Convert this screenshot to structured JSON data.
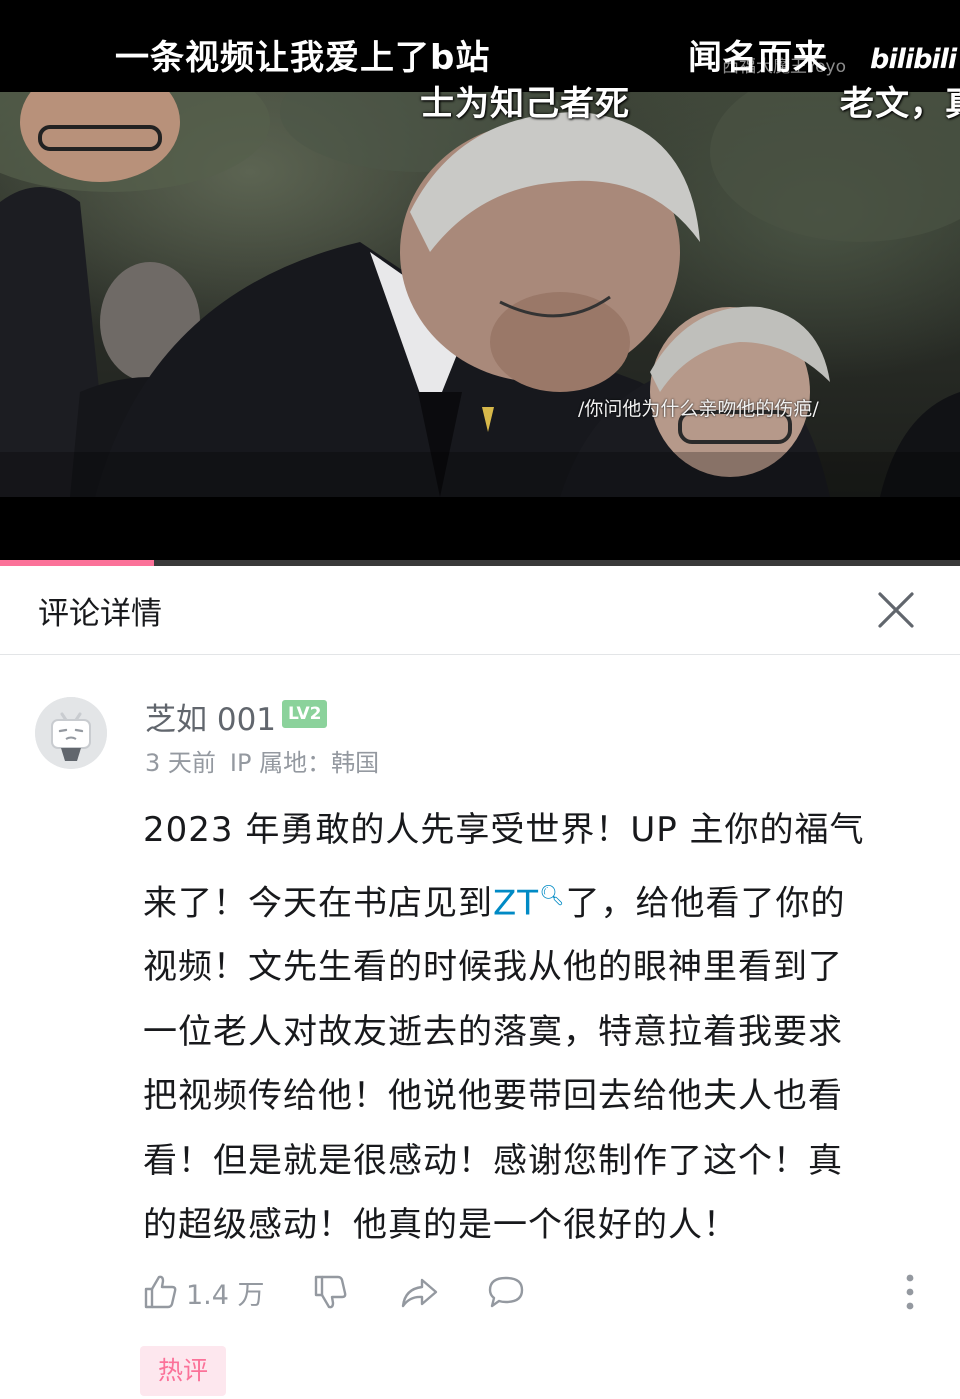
{
  "video": {
    "danmaku": [
      "一条视频让我爱上了b站",
      "闻名而来",
      "士为知己者死",
      "老文，真"
    ],
    "caption": "/你问他为什么亲吻他的伤疤/",
    "uploader_watermark": "西福大魔王Yoyo",
    "brand_logo": "bilibili",
    "progress_fraction": 0.16,
    "accent_color": "#fb7299"
  },
  "panel": {
    "title": "评论详情",
    "close_icon": "close-icon"
  },
  "comment": {
    "username": "芝如 001",
    "level": "LV2",
    "time": "3 天前",
    "ip_location": "IP 属地：韩国",
    "lines": [
      "2023 年勇敢的人先享受世界！UP 主你的福气",
      "视频！文先生看的时候我从他的眼神里看到了",
      "一位老人对故友逝去的落寞，特意拉着我要求",
      "把视频传给他！他说他要带回去给他夫人也看",
      "看！但是就是很感动！感谢您制作了这个！真",
      "的超级感动！他真的是一个很好的人！"
    ],
    "line2_before": "来了！今天在书店见到",
    "line2_keyword": "ZT",
    "line2_after": "了，给他看了你的",
    "like_count": "1.4 万",
    "hot_badge": "热评"
  }
}
